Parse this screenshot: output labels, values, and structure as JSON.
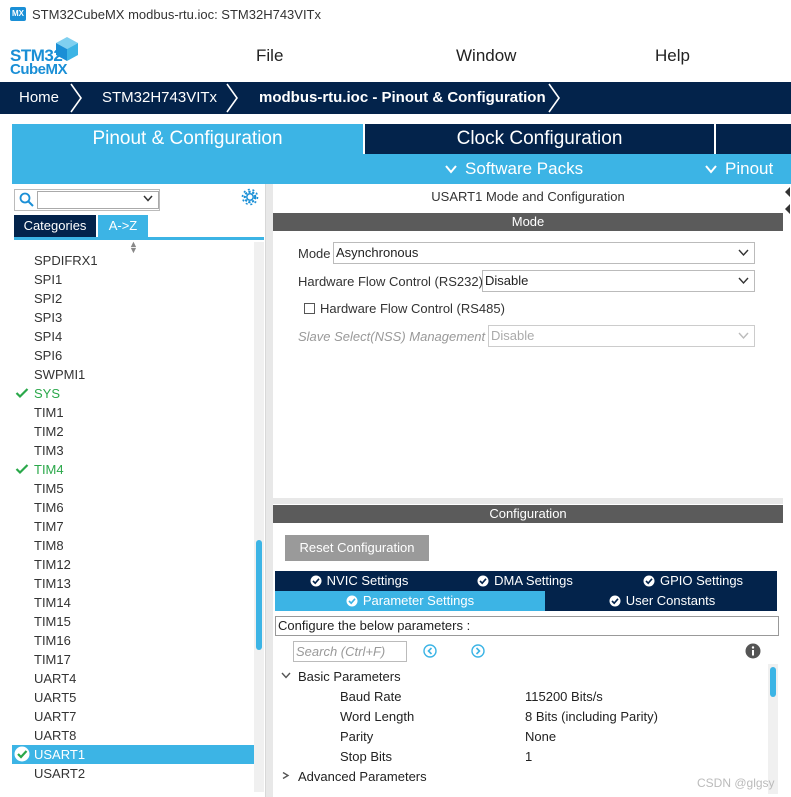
{
  "window": {
    "app_icon": "MX",
    "title": "STM32CubeMX modbus-rtu.ioc: STM32H743VITx"
  },
  "logo": {
    "line1": "STM32",
    "line2": "CubeMX"
  },
  "menu": [
    "File",
    "Window",
    "Help"
  ],
  "breadcrumb": [
    "Home",
    "STM32H743VITx",
    "modbus-rtu.ioc - Pinout & Configuration"
  ],
  "main_tabs": [
    "Pinout & Configuration",
    "Clock Configuration"
  ],
  "sub_bar": {
    "software_packs": "Software Packs",
    "pinout": "Pinout"
  },
  "left": {
    "tabs": {
      "categories": "Categories",
      "az": "A->Z"
    },
    "items": [
      {
        "label": "SPDIFRX1",
        "state": "normal"
      },
      {
        "label": "SPI1",
        "state": "normal"
      },
      {
        "label": "SPI2",
        "state": "normal"
      },
      {
        "label": "SPI3",
        "state": "normal"
      },
      {
        "label": "SPI4",
        "state": "normal"
      },
      {
        "label": "SPI6",
        "state": "normal"
      },
      {
        "label": "SWPMI1",
        "state": "normal"
      },
      {
        "label": "SYS",
        "state": "enabled"
      },
      {
        "label": "TIM1",
        "state": "normal"
      },
      {
        "label": "TIM2",
        "state": "normal"
      },
      {
        "label": "TIM3",
        "state": "normal"
      },
      {
        "label": "TIM4",
        "state": "enabled"
      },
      {
        "label": "TIM5",
        "state": "normal"
      },
      {
        "label": "TIM6",
        "state": "normal"
      },
      {
        "label": "TIM7",
        "state": "normal"
      },
      {
        "label": "TIM8",
        "state": "normal"
      },
      {
        "label": "TIM12",
        "state": "normal"
      },
      {
        "label": "TIM13",
        "state": "normal"
      },
      {
        "label": "TIM14",
        "state": "normal"
      },
      {
        "label": "TIM15",
        "state": "normal"
      },
      {
        "label": "TIM16",
        "state": "normal"
      },
      {
        "label": "TIM17",
        "state": "normal"
      },
      {
        "label": "UART4",
        "state": "normal"
      },
      {
        "label": "UART5",
        "state": "normal"
      },
      {
        "label": "UART7",
        "state": "normal"
      },
      {
        "label": "UART8",
        "state": "normal"
      },
      {
        "label": "USART1",
        "state": "selected"
      },
      {
        "label": "USART2",
        "state": "normal"
      }
    ]
  },
  "right": {
    "title": "USART1 Mode and Configuration",
    "mode_header": "Mode",
    "mode": {
      "label": "Mode",
      "value": "Asynchronous"
    },
    "flow232": {
      "label": "Hardware Flow Control (RS232)",
      "value": "Disable"
    },
    "rs485": {
      "label": "Hardware Flow Control (RS485)",
      "checked": false
    },
    "nss": {
      "label": "Slave Select(NSS) Management",
      "value": "Disable"
    },
    "config_header": "Configuration",
    "reset_label": "Reset Configuration",
    "cfg_tabs": {
      "nvic": "NVIC Settings",
      "dma": "DMA Settings",
      "gpio": "GPIO Settings",
      "params": "Parameter Settings",
      "constants": "User Constants"
    },
    "hint": "Configure the below parameters :",
    "search_placeholder": "Search (Ctrl+F)",
    "basic_header": "Basic Parameters",
    "params": [
      {
        "name": "Baud Rate",
        "value": "115200 Bits/s"
      },
      {
        "name": "Word Length",
        "value": "8 Bits (including Parity)"
      },
      {
        "name": "Parity",
        "value": "None"
      },
      {
        "name": "Stop Bits",
        "value": "1"
      }
    ],
    "advanced_header": "Advanced Parameters"
  },
  "watermark": "CSDN @glgsy",
  "colors": {
    "navy": "#03234b",
    "accent": "#3cb4e5",
    "enabled_green": "#2aa84a",
    "section_gray": "#5b5b5b"
  }
}
